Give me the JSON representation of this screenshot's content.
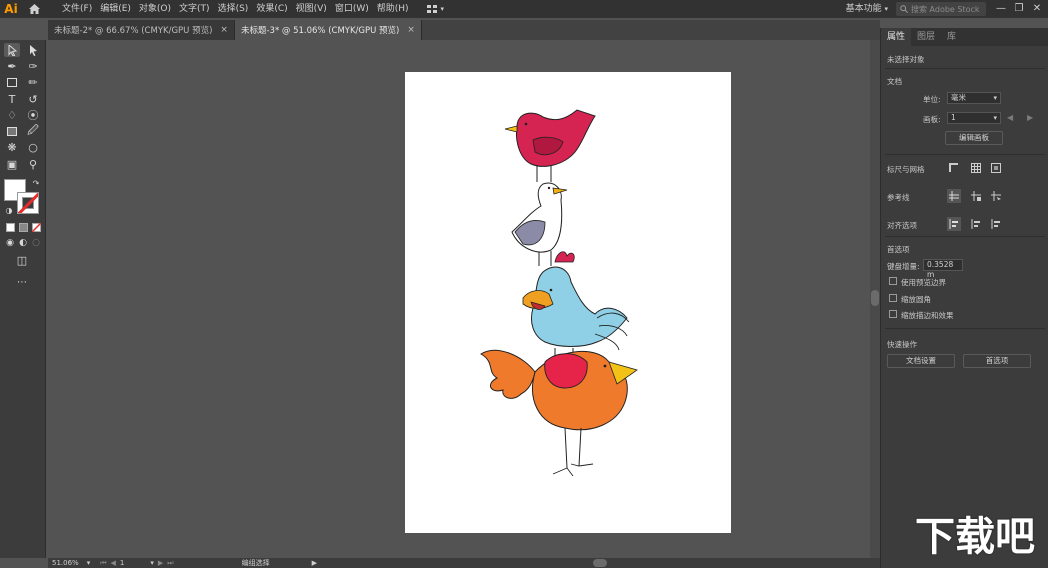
{
  "app": {
    "logo": "Ai",
    "workspace": "基本功能",
    "stock_placeholder": "搜索 Adobe Stock"
  },
  "menu": [
    "文件(F)",
    "编辑(E)",
    "对象(O)",
    "文字(T)",
    "选择(S)",
    "效果(C)",
    "视图(V)",
    "窗口(W)",
    "帮助(H)"
  ],
  "tabs": [
    {
      "label": "未标题-2* @ 66.67% (CMYK/GPU 预览)",
      "close": "×",
      "active": false
    },
    {
      "label": "未标题-3* @ 51.06% (CMYK/GPU 预览)",
      "close": "×",
      "active": true
    }
  ],
  "panel": {
    "tabs": [
      "属性",
      "图层",
      "库"
    ],
    "no_selection": "未选择对象",
    "document": "文档",
    "units_label": "单位:",
    "units_value": "毫米",
    "artboard_label": "画板:",
    "artboard_value": "1",
    "edit_artboards": "编辑画板",
    "rulers_grid": "标尺与网格",
    "guides": "参考线",
    "align_options": "对齐选项",
    "preferences": "首选项",
    "keyboard_increment_label": "键盘增量:",
    "keyboard_increment_value": "0.3528 m",
    "use_preview_bounds": "使用预览边界",
    "scale_corners": "缩放圆角",
    "scale_strokes": "缩放描边和效果",
    "quick_actions": "快速操作",
    "doc_setup": "文档设置",
    "prefs_button": "首选项"
  },
  "status": {
    "zoom": "51.06%",
    "artboard": "1",
    "tool": "编组选择"
  },
  "watermark": "下载吧"
}
